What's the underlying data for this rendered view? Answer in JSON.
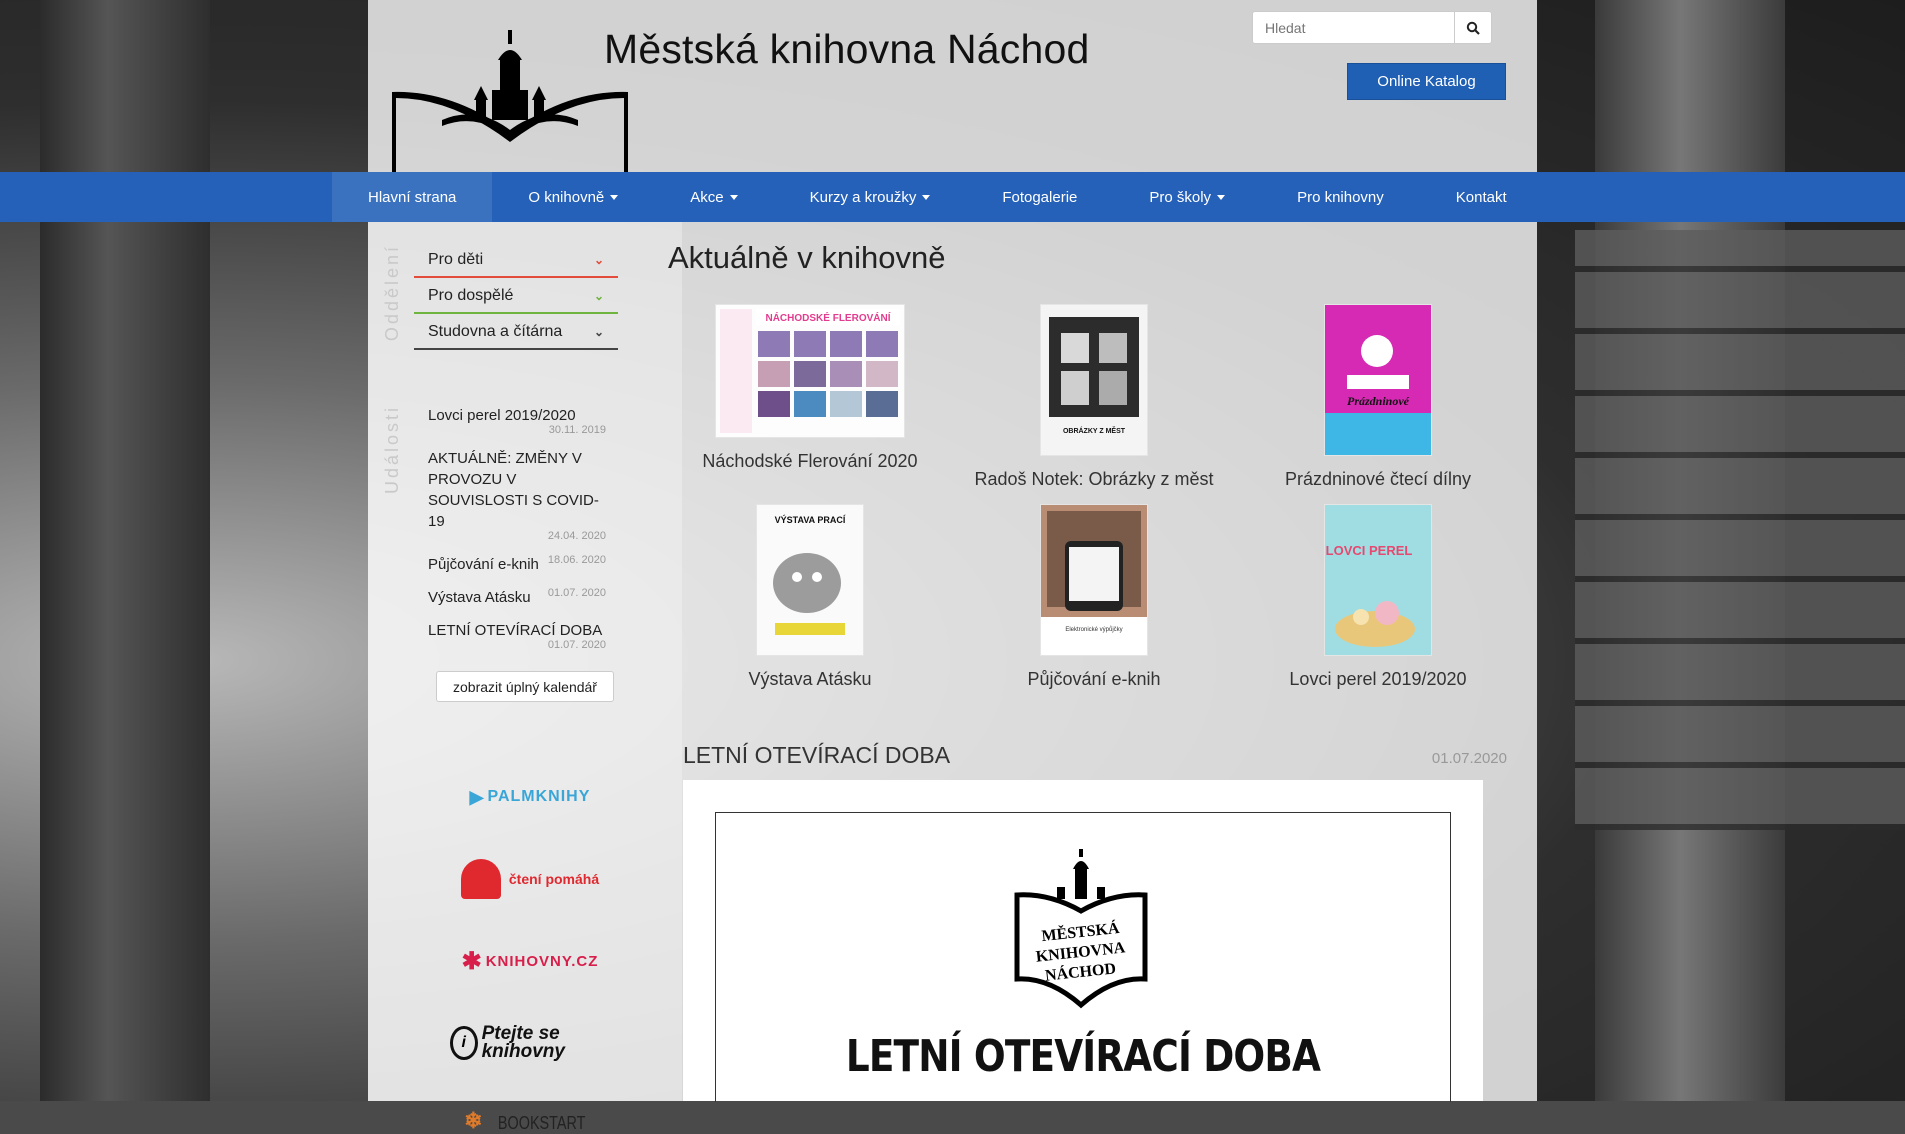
{
  "site": {
    "title": "Městská knihovna Náchod"
  },
  "search": {
    "placeholder": "Hledat"
  },
  "header": {
    "catalog_label": "Online Katalog"
  },
  "nav": {
    "items": [
      {
        "label": "Hlavní strana",
        "dropdown": false,
        "active": true
      },
      {
        "label": "O knihovně",
        "dropdown": true
      },
      {
        "label": "Akce",
        "dropdown": true
      },
      {
        "label": "Kurzy a kroužky",
        "dropdown": true
      },
      {
        "label": "Fotogalerie",
        "dropdown": false
      },
      {
        "label": "Pro školy",
        "dropdown": true
      },
      {
        "label": "Pro knihovny",
        "dropdown": false
      },
      {
        "label": "Kontakt",
        "dropdown": false
      }
    ]
  },
  "sidebar": {
    "departments_label": "Oddělení",
    "departments": [
      {
        "label": "Pro děti",
        "color": "#e34b3a"
      },
      {
        "label": "Pro dospělé",
        "color": "#6fb43f"
      },
      {
        "label": "Studovna a čítárna",
        "color": "#444444"
      }
    ],
    "events_label": "Události",
    "events": [
      {
        "title": "Lovci perel 2019/2020",
        "date": "30.11. 2019"
      },
      {
        "title": "AKTUÁLNĚ: ZMĚNY V PROVOZU V SOUVISLOSTI S COVID-19",
        "date": "24.04. 2020"
      },
      {
        "title": "Půjčování e-knih",
        "date": "18.06. 2020"
      },
      {
        "title": "Výstava Atásku",
        "date": "01.07. 2020"
      },
      {
        "title": "LETNÍ OTEVÍRACÍ DOBA",
        "date": "01.07. 2020"
      }
    ],
    "calendar_button": "zobrazit úplný kalendář",
    "partners": [
      {
        "name": "PALMKNIHY",
        "icon": "palmknihy-logo"
      },
      {
        "name": "čtení pomáhá",
        "icon": "cteni-pomaha-logo"
      },
      {
        "name": "KNIHOVNY.CZ",
        "icon": "knihovny-cz-logo"
      },
      {
        "name": "Ptejte se knihovny",
        "icon": "ptejte-se-knihovny-logo"
      },
      {
        "name": "BOOKSTART",
        "icon": "bookstart-logo"
      }
    ]
  },
  "main": {
    "section_title": "Aktuálně v knihovně",
    "tiles": [
      {
        "caption": "Náchodské Flerování 2020",
        "poster_text": "NÁCHODSKÉ FLEROVÁNÍ"
      },
      {
        "caption": "Radoš Notek: Obrázky z měst",
        "poster_text": "OBRÁZKY Z MĚST"
      },
      {
        "caption": "Prázdninové čtecí dílny",
        "poster_text": "Prázdninové"
      },
      {
        "caption": "Výstava Atásku",
        "poster_text": "VÝSTAVA PRACÍ"
      },
      {
        "caption": "Půjčování e-knih",
        "poster_text": "Elektronické výpůjčky"
      },
      {
        "caption": "Lovci perel 2019/2020",
        "poster_text": "LOVCI PEREL"
      }
    ],
    "post": {
      "title": "LETNÍ OTEVÍRACÍ DOBA",
      "date": "01.07.2020",
      "heading": "LETNÍ OTEVÍRACÍ DOBA",
      "logo_text": "MĚSTSKÁ KNIHOVNA NÁCHOD"
    }
  },
  "colors": {
    "nav_bg": "#2561b8",
    "catalog_btn": "#1f5fb4"
  }
}
